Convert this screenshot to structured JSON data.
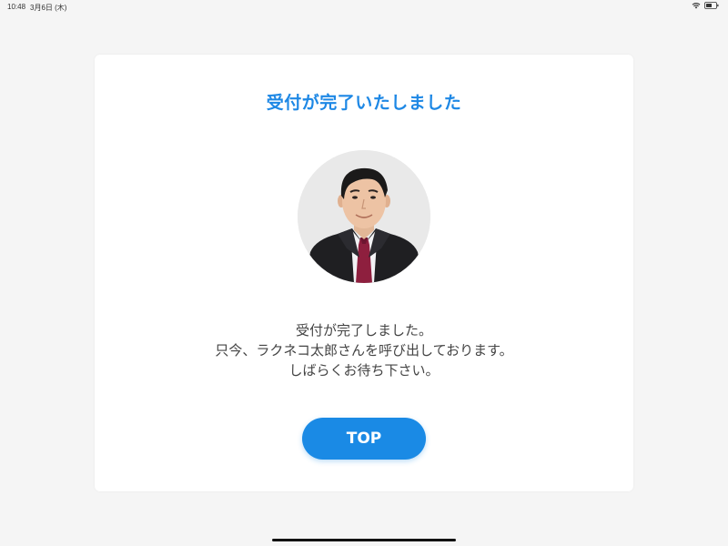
{
  "status_bar": {
    "time": "10:48",
    "date": "3月6日 (木)",
    "icons": [
      "wifi-icon",
      "battery-icon"
    ]
  },
  "card": {
    "title": "受付が完了いたしました",
    "avatar_description": "staff-photo",
    "message_lines": [
      "受付が完了しました。",
      "只今、ラクネコ太郎さんを呼び出しております。",
      "しばらくお待ち下さい。"
    ],
    "button_label": "TOP"
  },
  "colors": {
    "accent": "#1a8ae5",
    "title": "#1e88e5",
    "background": "#f5f5f5",
    "card": "#ffffff",
    "text": "#444444"
  }
}
